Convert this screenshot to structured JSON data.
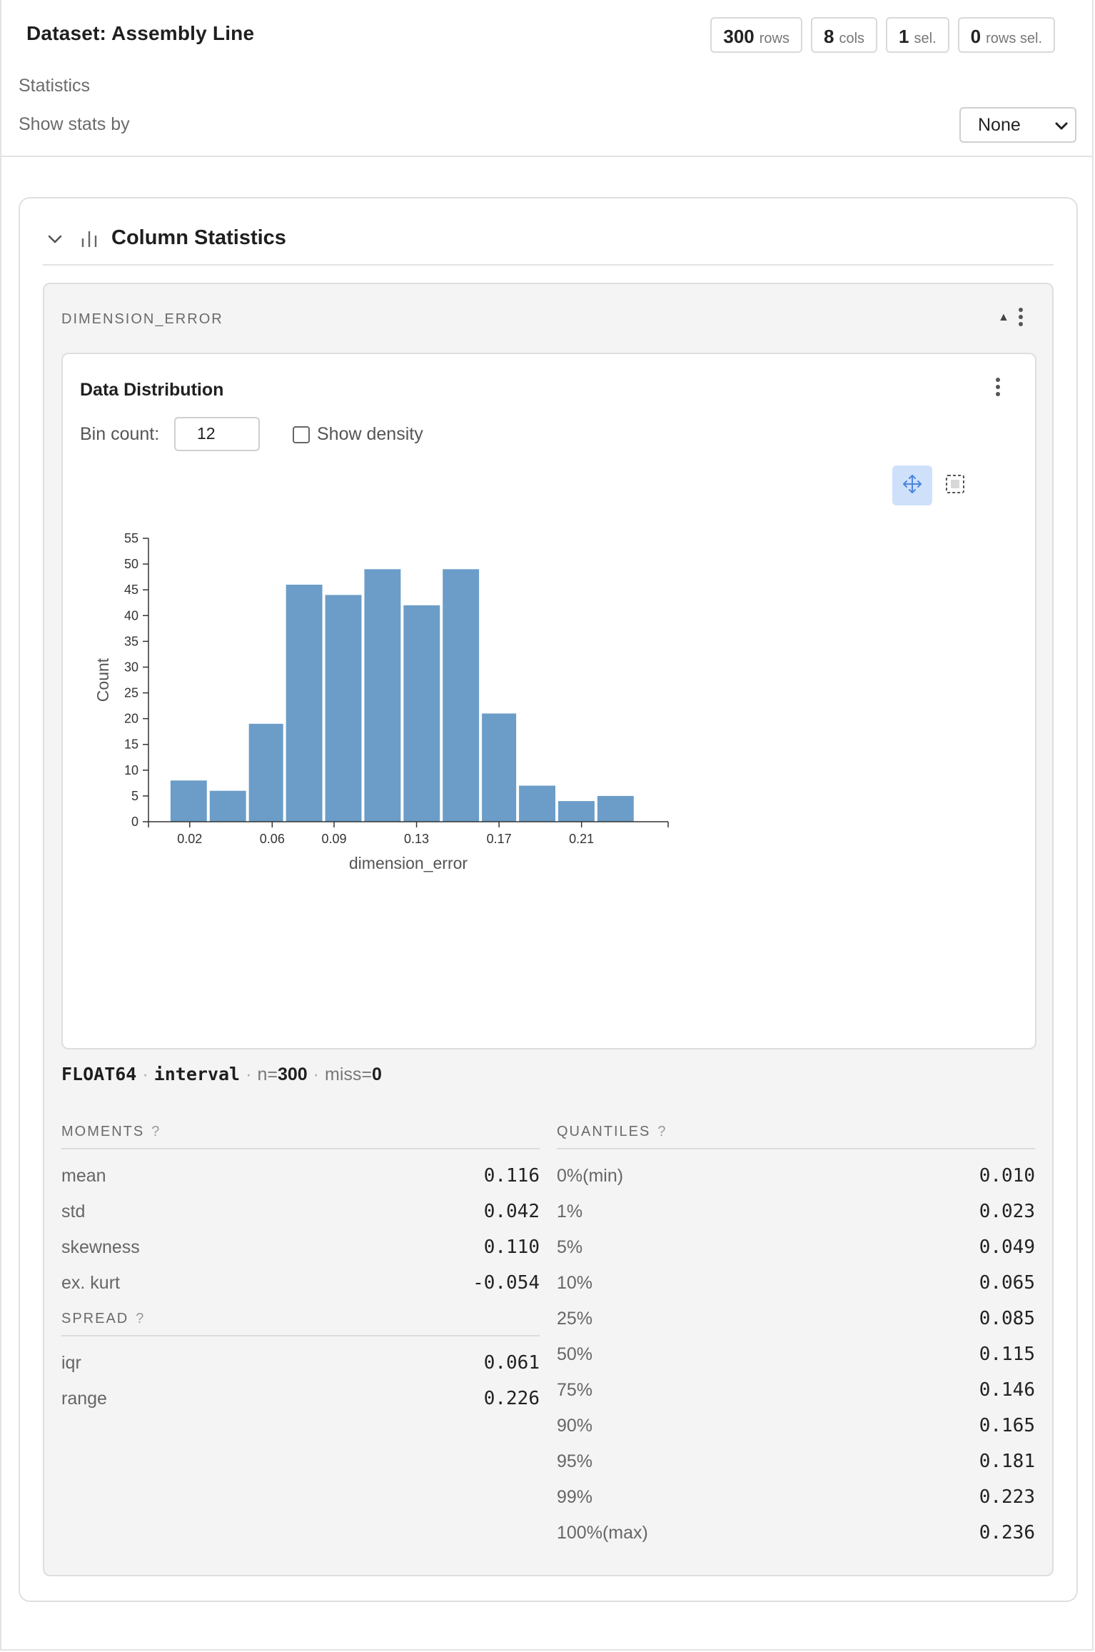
{
  "header": {
    "title": "Dataset: Assembly Line",
    "chips": [
      {
        "num": "300",
        "unit": "rows"
      },
      {
        "num": "8",
        "unit": "cols"
      },
      {
        "num": "1",
        "unit": "sel."
      },
      {
        "num": "0",
        "unit": "rows sel."
      }
    ],
    "statistics_label": "Statistics",
    "show_stats_by_label": "Show stats by",
    "show_stats_by_value": "None"
  },
  "section": {
    "title": "Column Statistics"
  },
  "column": {
    "name": "DIMENSION_ERROR",
    "distribution": {
      "title": "Data Distribution",
      "bin_count_label": "Bin count:",
      "bin_count_value": "12",
      "show_density_label": "Show density",
      "show_density_checked": false
    },
    "type_line": {
      "dtype": "FLOAT64",
      "kind": "interval",
      "n_label": "n=",
      "n_value": "300",
      "miss_label": "miss=",
      "miss_value": "0"
    },
    "moments": {
      "title": "MOMENTS",
      "help": "?",
      "rows": [
        {
          "k": "mean",
          "v": "0.116"
        },
        {
          "k": "std",
          "v": "0.042"
        },
        {
          "k": "skewness",
          "v": "0.110"
        },
        {
          "k": "ex. kurt",
          "v": "-0.054"
        }
      ]
    },
    "spread": {
      "title": "SPREAD",
      "help": "?",
      "rows": [
        {
          "k": "iqr",
          "v": "0.061"
        },
        {
          "k": "range",
          "v": "0.226"
        }
      ]
    },
    "quantiles": {
      "title": "QUANTILES",
      "help": "?",
      "rows": [
        {
          "k": "0%(min)",
          "v": "0.010"
        },
        {
          "k": "1%",
          "v": "0.023"
        },
        {
          "k": "5%",
          "v": "0.049"
        },
        {
          "k": "10%",
          "v": "0.065"
        },
        {
          "k": "25%",
          "v": "0.085"
        },
        {
          "k": "50%",
          "v": "0.115"
        },
        {
          "k": "75%",
          "v": "0.146"
        },
        {
          "k": "90%",
          "v": "0.165"
        },
        {
          "k": "95%",
          "v": "0.181"
        },
        {
          "k": "99%",
          "v": "0.223"
        },
        {
          "k": "100%(max)",
          "v": "0.236"
        }
      ]
    }
  },
  "chart_data": {
    "type": "bar",
    "xlabel": "dimension_error",
    "ylabel": "Count",
    "bar_color": "#6b9dc8",
    "bins": [
      {
        "x0": 0.01,
        "x1": 0.029,
        "count": 8
      },
      {
        "x0": 0.029,
        "x1": 0.048,
        "count": 6
      },
      {
        "x0": 0.048,
        "x1": 0.066,
        "count": 19
      },
      {
        "x0": 0.066,
        "x1": 0.085,
        "count": 46
      },
      {
        "x0": 0.085,
        "x1": 0.104,
        "count": 44
      },
      {
        "x0": 0.104,
        "x1": 0.123,
        "count": 49
      },
      {
        "x0": 0.123,
        "x1": 0.142,
        "count": 42
      },
      {
        "x0": 0.142,
        "x1": 0.161,
        "count": 49
      },
      {
        "x0": 0.161,
        "x1": 0.179,
        "count": 21
      },
      {
        "x0": 0.179,
        "x1": 0.198,
        "count": 7
      },
      {
        "x0": 0.198,
        "x1": 0.217,
        "count": 4
      },
      {
        "x0": 0.217,
        "x1": 0.236,
        "count": 5
      }
    ],
    "xticks": [
      0.02,
      0.06,
      0.09,
      0.13,
      0.17,
      0.21
    ],
    "xtick_labels": [
      "0.02",
      "0.06",
      "0.09",
      "0.13",
      "0.17",
      "0.21"
    ],
    "xlim": [
      0.0,
      0.252
    ],
    "yticks": [
      0,
      5,
      10,
      15,
      20,
      25,
      30,
      35,
      40,
      45,
      50,
      55
    ],
    "ylim": [
      0,
      55
    ],
    "grid": false
  }
}
